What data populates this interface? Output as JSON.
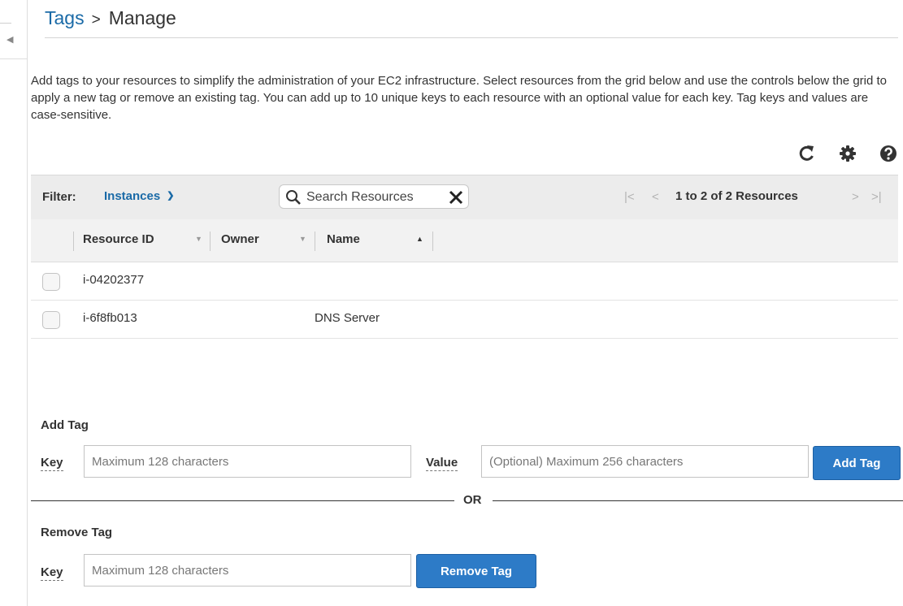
{
  "breadcrumb": {
    "parent": "Tags",
    "separator": ">",
    "current": "Manage"
  },
  "description": "Add tags to your resources to simplify the administration of your EC2 infrastructure. Select resources from the grid below and use the controls below the grid to apply a new tag or remove an existing tag. You can add up to 10 unique keys to each resource with an optional value for each key. Tag keys and values are case-sensitive.",
  "toolbar": {
    "icons": [
      "refresh-icon",
      "settings-gear-icon",
      "help-icon"
    ]
  },
  "filter": {
    "label": "Filter:",
    "selected": "Instances",
    "search_placeholder": "Search Resources",
    "pagination_text": "1 to 2 of 2 Resources"
  },
  "grid": {
    "columns": [
      "Resource ID",
      "Owner",
      "Name"
    ],
    "sort_column": "Name",
    "rows": [
      {
        "resource_id": "i-04202377",
        "owner": "",
        "name": ""
      },
      {
        "resource_id": "i-6f8fb013",
        "owner": "",
        "name": "DNS Server"
      }
    ]
  },
  "add_tag": {
    "title": "Add Tag",
    "key_label": "Key",
    "key_placeholder": "Maximum 128 characters",
    "value_label": "Value",
    "value_placeholder": "(Optional) Maximum 256 characters",
    "button": "Add Tag"
  },
  "divider": "OR",
  "remove_tag": {
    "title": "Remove Tag",
    "key_label": "Key",
    "key_placeholder": "Maximum 128 characters",
    "button": "Remove Tag"
  },
  "colors": {
    "link": "#1a6aa7",
    "button": "#2d7bc7",
    "filter_bar_bg": "#ececec"
  }
}
